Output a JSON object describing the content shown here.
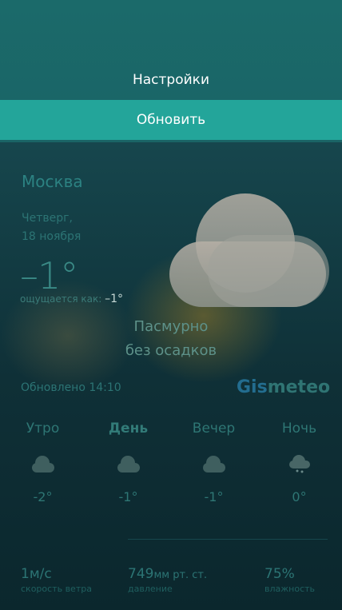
{
  "menu": {
    "settings_label": "Настройки",
    "update_label": "Обновить"
  },
  "weather": {
    "city": "Москва",
    "day_name": "Четверг,",
    "date": "18 ноября",
    "temperature": "–1°",
    "feels_label": "ощущается как:",
    "feels_value": "–1°",
    "condition_line1": "Пасмурно",
    "condition_line2": "без осадков",
    "updated": "Обновлено 14:10",
    "brand_part1": "Gis",
    "brand_part2": "meteo",
    "icon": "cloud-icon"
  },
  "periods": [
    {
      "label": "Утро",
      "temp": "-2°",
      "icon": "cloud-icon",
      "active": false
    },
    {
      "label": "День",
      "temp": "-1°",
      "icon": "cloud-icon",
      "active": true
    },
    {
      "label": "Вечер",
      "temp": "-1°",
      "icon": "cloud-icon",
      "active": false
    },
    {
      "label": "Ночь",
      "temp": "0°",
      "icon": "cloud-snow-icon",
      "active": false
    }
  ],
  "stats": {
    "wind_value": "1м/с",
    "wind_label": "скорость ветра",
    "pressure_value": "749",
    "pressure_unit": "мм рт. ст.",
    "pressure_label": "давление",
    "humidity_value": "75%",
    "humidity_label": "влажность"
  },
  "colors": {
    "accent": "#23a59a",
    "panel": "#1b6a6a"
  }
}
